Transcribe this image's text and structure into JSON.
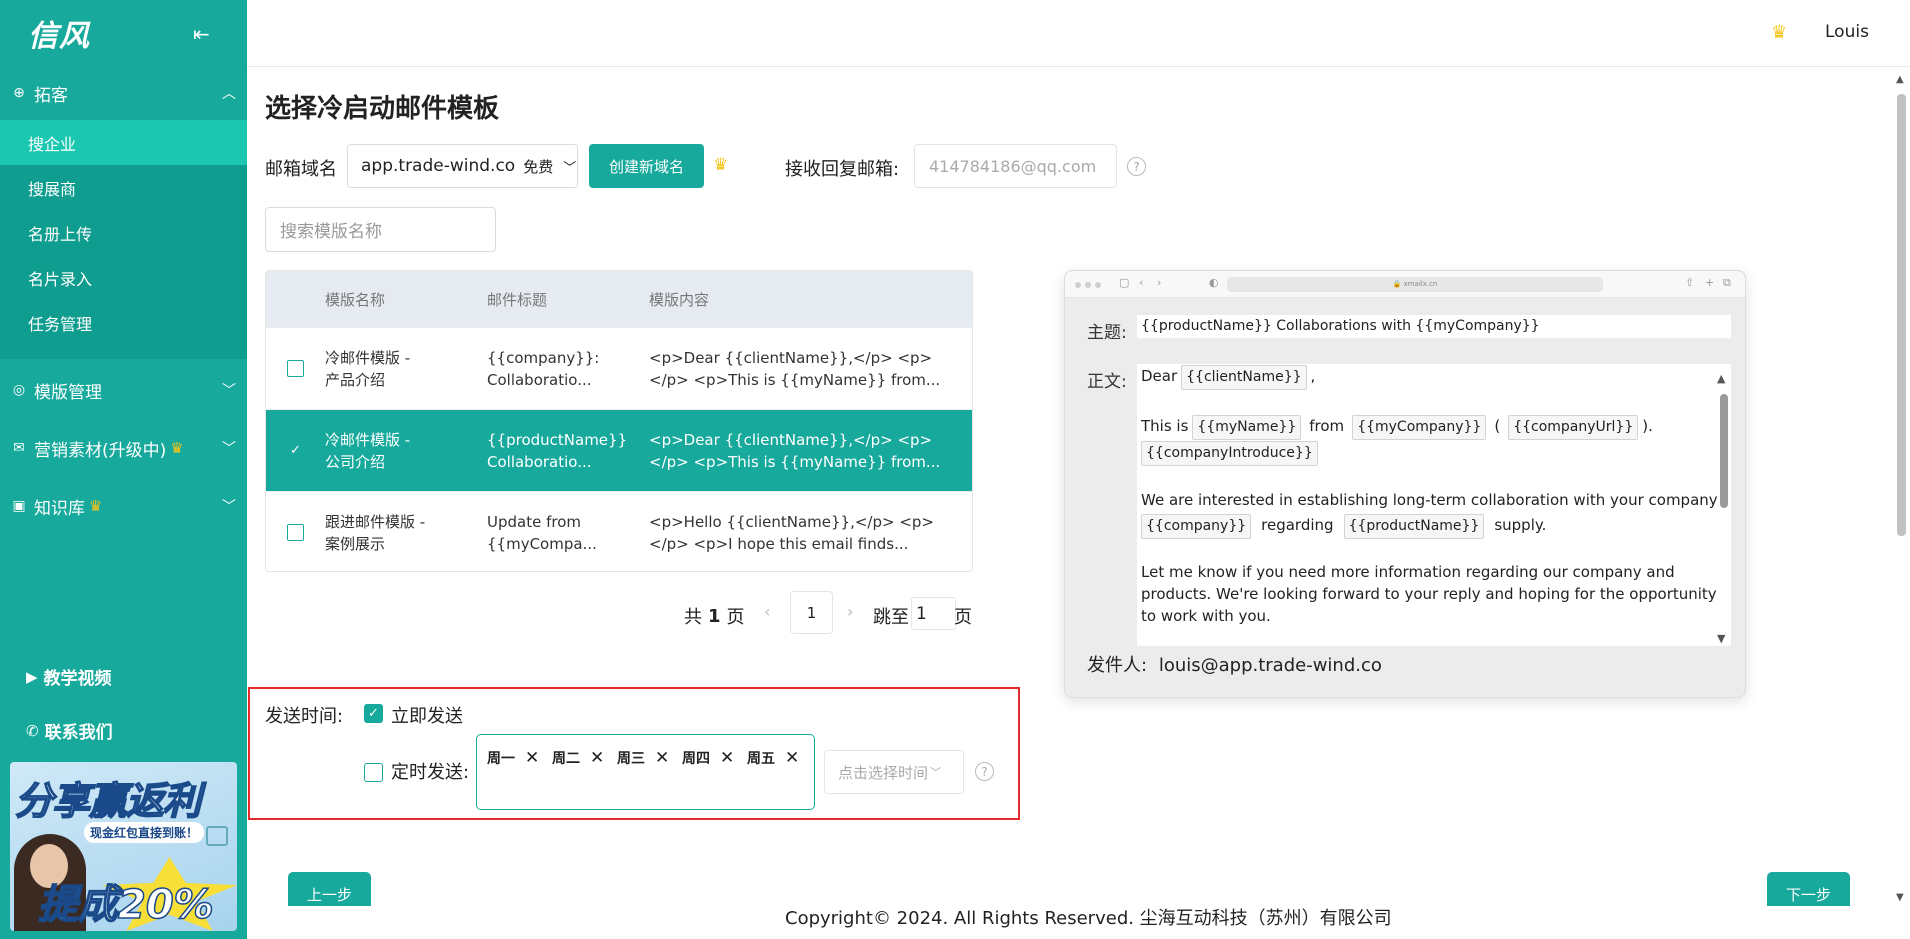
{
  "sidebar": {
    "logo": "信风",
    "menu_icon": "menu-fold-icon",
    "groups": [
      {
        "label": "拓客",
        "icon": "search-icon"
      },
      {
        "label": "模版管理",
        "icon": "check-circle-icon"
      },
      {
        "label": "营销素材(升级中)",
        "icon": "mail-icon"
      },
      {
        "label": "知识库",
        "icon": "book-icon"
      }
    ],
    "sub_items": [
      "搜企业",
      "搜展商",
      "名册上传",
      "名片录入",
      "任务管理"
    ],
    "bottom_links": [
      "教学视频",
      "联系我们"
    ],
    "promo": {
      "title": "分享赢返利",
      "subtitle": "现金红包直接到账！",
      "big": "提成20%"
    }
  },
  "header": {
    "user": "Louis",
    "crown_icon": "crown-icon"
  },
  "page": {
    "title": "选择冷启动邮件模板",
    "domain_label": "邮箱域名",
    "domain_value": "app.trade-wind.co",
    "domain_tag": "免费",
    "create_domain_button": "创建新域名",
    "reply_label": "接收回复邮箱:",
    "reply_placeholder": "414784186@qq.com",
    "search_placeholder": "搜索模版名称"
  },
  "table": {
    "headers": [
      "模版名称",
      "邮件标题",
      "模版内容"
    ],
    "rows": [
      {
        "name1": "冷邮件模版 -",
        "name2": "产品介绍",
        "title1": "{{company}}:",
        "title2": "Collaboratio...",
        "content1": "<p>Dear {{clientName}},</p> <p>",
        "content2": "</p> <p>This is {{myName}} from...",
        "selected": false
      },
      {
        "name1": "冷邮件模版 -",
        "name2": "公司介绍",
        "title1": "{{productName}}",
        "title2": "Collaboratio...",
        "content1": "<p>Dear {{clientName}},</p> <p>",
        "content2": "</p> <p>This is {{myName}} from...",
        "selected": true
      },
      {
        "name1": "跟进邮件模版 -",
        "name2": "案例展示",
        "title1": "Update from",
        "title2": "{{myCompa...",
        "content1": "<p>Hello {{clientName}},</p> <p>",
        "content2": "</p> <p>I hope this email finds...",
        "selected": false
      }
    ]
  },
  "pager": {
    "total_prefix": "共",
    "total": "1",
    "total_suffix": "页",
    "current": "1",
    "jump_prefix": "跳至",
    "jump_value": "1",
    "jump_suffix": "页",
    "prev_icon": "chevron-left-icon",
    "next_icon": "chevron-right-icon"
  },
  "send": {
    "label": "发送时间:",
    "immediate": "立即发送",
    "immediate_checked": true,
    "scheduled": "定时发送:",
    "scheduled_checked": false,
    "days": [
      "周一",
      "周二",
      "周三",
      "周四",
      "周五"
    ],
    "time_placeholder": "点击选择时间"
  },
  "buttons": {
    "prev": "上一步",
    "next": "下一步"
  },
  "footer": "Copyright© 2024. All Rights Reserved. 尘海互动科技（苏州）有限公司",
  "preview": {
    "url": "🔒 xmailx.cn",
    "subject_label": "主题:",
    "subject": "{{productName}} Collaborations with {{myCompany}}",
    "body_label": "正文:",
    "dear": "Dear",
    "client_var": "{{clientName}}",
    "comma": ",",
    "this_is": "This is",
    "my_name_var": "{{myName}}",
    "from": "from",
    "my_company_var": "{{myCompany}}",
    "paren_open": "(",
    "company_url_var": "{{companyUrl}}",
    "paren_close": ").",
    "company_intro_var": "{{companyIntroduce}}",
    "interested": "We are interested in establishing long-term collaboration with your company",
    "company_var": "{{company}}",
    "regarding": "regarding",
    "product_var": "{{productName}}",
    "supply": "supply.",
    "p3_1": "Let me know if you need more information regarding our company and",
    "p3_2": "products. We're looking forward to your reply and hoping for the opportunity",
    "p3_3": "to work with you.",
    "sender_label": "发件人:",
    "sender": "louis@app.trade-wind.co"
  },
  "colors": {
    "primary": "#17a99c",
    "active_sub": "#1cc7b2",
    "highlight_border": "#e32b2b",
    "crown": "#f5c518"
  }
}
